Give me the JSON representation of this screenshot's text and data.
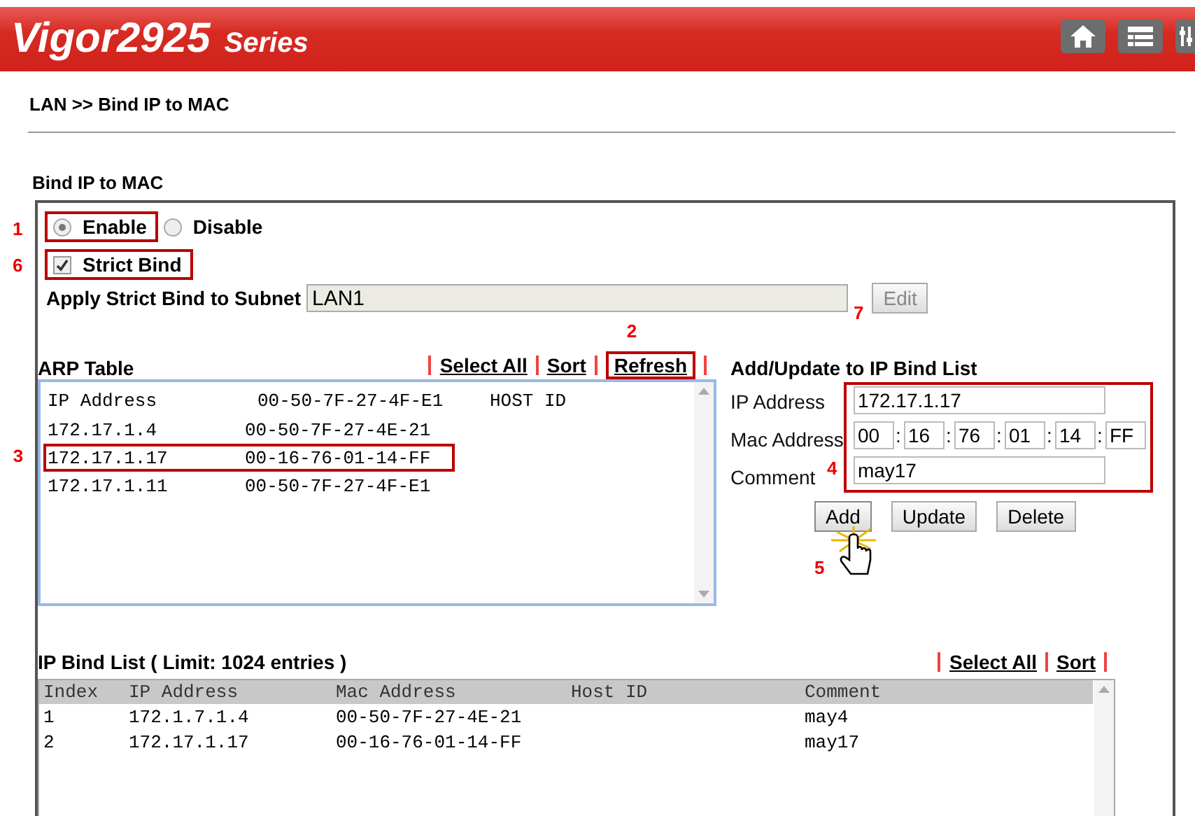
{
  "header": {
    "brand": "Vigor2925",
    "series": "Series"
  },
  "breadcrumb": "LAN >> Bind IP to MAC",
  "section_title": "Bind IP to MAC",
  "mode": {
    "callout": "1",
    "options": [
      {
        "label": "Enable",
        "selected": true
      },
      {
        "label": "Disable",
        "selected": false
      }
    ]
  },
  "strict_bind": {
    "label": "Strict Bind",
    "checked": true,
    "callout": "6"
  },
  "subnet": {
    "label": "Apply Strict Bind to Subnet",
    "value": "LAN1",
    "callout": "7",
    "button": {
      "label": "Edit",
      "disabled": true
    }
  },
  "arp_table": {
    "title": "ARP Table",
    "links": [
      {
        "label": "Select All"
      },
      {
        "label": "Sort"
      },
      {
        "label": "Refresh",
        "callout": "2"
      }
    ],
    "header": [
      "IP Address",
      "00-50-7F-27-4F-E1",
      "HOST ID"
    ],
    "rows": [
      {
        "ip": "172.17.1.4",
        "mac": "00-50-7F-27-4E-21"
      },
      {
        "ip": "172.17.1.17",
        "mac": "00-16-76-01-14-FF",
        "callout": "3"
      },
      {
        "ip": "172.17.1.11",
        "mac": "00-50-7F-27-4F-E1"
      }
    ]
  },
  "bind_form": {
    "title": "Add/Update to IP Bind List",
    "callout": "4",
    "ip_label": "IP Address",
    "ip_value": "172.17.1.17",
    "mac_label": "Mac Address",
    "mac_octets": [
      "00",
      "16",
      "76",
      "01",
      "14",
      "FF"
    ],
    "mac_separator": ":",
    "comment_label": "Comment",
    "comment_value": "may17",
    "buttons": [
      {
        "label": "Add",
        "clicked": true,
        "callout": "5"
      },
      {
        "label": "Update",
        "clicked": false
      },
      {
        "label": "Delete",
        "clicked": false
      }
    ]
  },
  "bind_list": {
    "title": "IP Bind List ( Limit: 1024 entries )",
    "links": [
      "Select All",
      "Sort"
    ],
    "columns": [
      "Index",
      "IP Address",
      "Mac Address",
      "Host ID",
      "Comment"
    ],
    "rows": [
      [
        "1",
        "172.1.7.1.4",
        "00-50-7F-27-4E-21",
        "",
        "may4"
      ],
      [
        "2",
        "172.17.1.17",
        "00-16-76-01-14-FF",
        "",
        "may17"
      ]
    ]
  }
}
